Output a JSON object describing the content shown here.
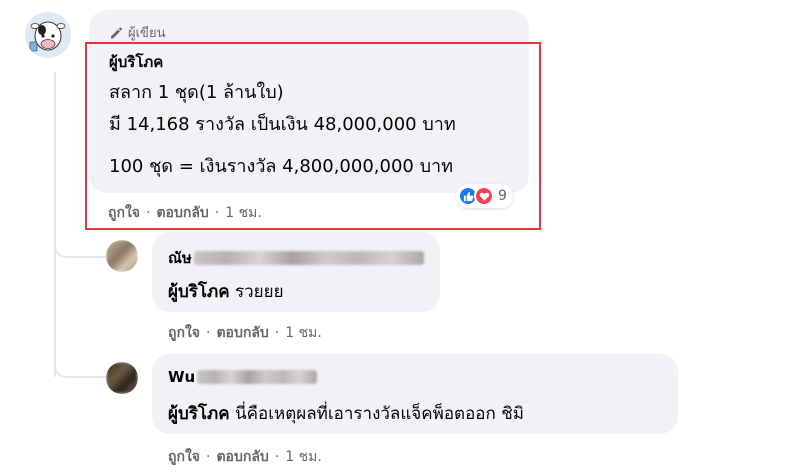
{
  "colors": {
    "bubble_bg": "#f0f2f5",
    "highlight_border": "#e0383a",
    "like_blue": "#1877f2",
    "love_red": "#f33e58",
    "muted_text": "#65676b"
  },
  "main_comment": {
    "author_badge": "ผู้เขียน",
    "author_name": "ผู้บริโภค",
    "lines": [
      "สลาก 1 ชุด(1 ล้านใบ)",
      "มี 14,168 รางวัล เป็นเงิน 48,000,000 บาท",
      "100 ชุด = เงินรางวัล 4,800,000,000 บาท"
    ],
    "reaction_icons": [
      "like-icon",
      "love-icon"
    ],
    "reaction_count": "9",
    "actions": {
      "like": "ถูกใจ",
      "reply": "ตอบกลับ",
      "time": "1 ชม."
    }
  },
  "replies": [
    {
      "author_visible": "ณัษ",
      "text_mention": "ผู้บริโภค",
      "text": "รวยยย",
      "actions": {
        "like": "ถูกใจ",
        "reply": "ตอบกลับ",
        "time": "1 ชม."
      }
    },
    {
      "author_visible": "Wu",
      "text_mention": "ผู้บริโภค",
      "text": "นี่คือเหตุผลที่เอารางวัลแจ็คพ็อตออก ชิมิ",
      "actions": {
        "like": "ถูกใจ",
        "reply": "ตอบกลับ",
        "time": "1 ชม."
      }
    }
  ],
  "separator": "·"
}
